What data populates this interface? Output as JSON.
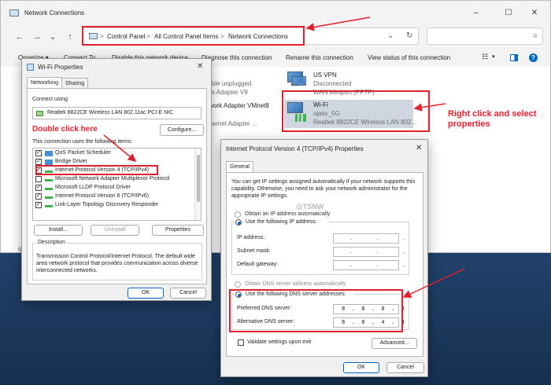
{
  "explorer": {
    "title": "Network Connections",
    "window_controls": {
      "minimize": "–",
      "maximize": "☐",
      "close": "✕"
    },
    "nav": {
      "back": "←",
      "forward": "→",
      "dropdown": "⌄",
      "up": "↑"
    },
    "breadcrumb": [
      "Control Panel",
      "All Control Panel Items",
      "Network Connections"
    ],
    "breadcrumb_separator": ">",
    "toolbar": {
      "organize": "Organize ▾",
      "connect_to": "Connect To",
      "disable": "Disable this network device",
      "diagnose": "Diagnose this connection",
      "rename": "Rename this connection",
      "view_status": "View status of this connection"
    },
    "connections": [
      {
        "name": "US VPN",
        "status": "Disconnected",
        "adapter": "WAN Miniport (PPTP)"
      },
      {
        "name": "Wi-Fi",
        "status": "ojasv_5G",
        "adapter": "Realtek 8822CE Wireless LAN 802..."
      }
    ],
    "hidden_items": {
      "item1_status": "ble unplugged",
      "item1_adapter": "s Adapter V9",
      "item2_name": "twork Adapter VMnet8",
      "item3_adapter": "thernet Adapter ..."
    },
    "item_count": "6"
  },
  "wifi_properties": {
    "title": "Wi-Fi Properties",
    "tabs": [
      "Networking",
      "Sharing"
    ],
    "connect_using_label": "Connect using:",
    "adapter_name": "Realtek 8822CE Wireless LAN 802.11ac PCI-E NIC",
    "configure_button": "Configure...",
    "items_label": "This connection uses the following items:",
    "items": [
      {
        "label": "QoS Packet Scheduler",
        "checked": true
      },
      {
        "label": "Bridge Driver",
        "checked": true
      },
      {
        "label": "Internet Protocol Version 4 (TCP/IPv4)",
        "checked": true
      },
      {
        "label": "Microsoft Network Adapter Multiplexor Protocol",
        "checked": false
      },
      {
        "label": "Microsoft LLDP Protocol Driver",
        "checked": true
      },
      {
        "label": "Internet Protocol Version 6 (TCP/IPv6)",
        "checked": true
      },
      {
        "label": "Link-Layer Topology Discovery Responder",
        "checked": true
      }
    ],
    "install_button": "Install...",
    "uninstall_button": "Uninstall",
    "properties_button": "Properties",
    "description_label": "Description",
    "description_text": "Transmission Control Protocol/Internet Protocol. The default wide area network protocol that provides communication across diverse interconnected networks.",
    "ok_button": "OK",
    "cancel_button": "Cancel"
  },
  "ipv4_properties": {
    "title": "Internet Protocol Version 4 (TCP/IPv4) Properties",
    "tab": "General",
    "intro": "You can get IP settings assigned automatically if your network supports this capability. Otherwise, you need to ask your network administrator for the appropriate IP settings.",
    "obtain_ip_auto": "Obtain an IP address automatically",
    "use_following_ip": "Use the following IP address:",
    "ip_address_label": "IP address:",
    "subnet_mask_label": "Subnet mask:",
    "default_gateway_label": "Default gateway:",
    "empty_ip": ".       .       .",
    "obtain_dns_auto": "Obtain DNS server address automatically",
    "use_following_dns": "Use the following DNS server addresses:",
    "preferred_dns_label": "Preferred DNS server:",
    "preferred_dns_value": "8  .  8  .  8  .  8",
    "alternative_dns_label": "Alternative DNS server:",
    "alternative_dns_value": "8  .  8  .  4  .  4",
    "validate_label": "Validate settings upon exit",
    "advanced_button": "Advanced...",
    "ok_button": "OK",
    "cancel_button": "Cancel"
  },
  "annotations": {
    "double_click": "Double click here",
    "right_click_line1": "Right click and select",
    "right_click_line2": "properties",
    "watermark": "@TSNW",
    "annotation_color": "#e0202e"
  }
}
